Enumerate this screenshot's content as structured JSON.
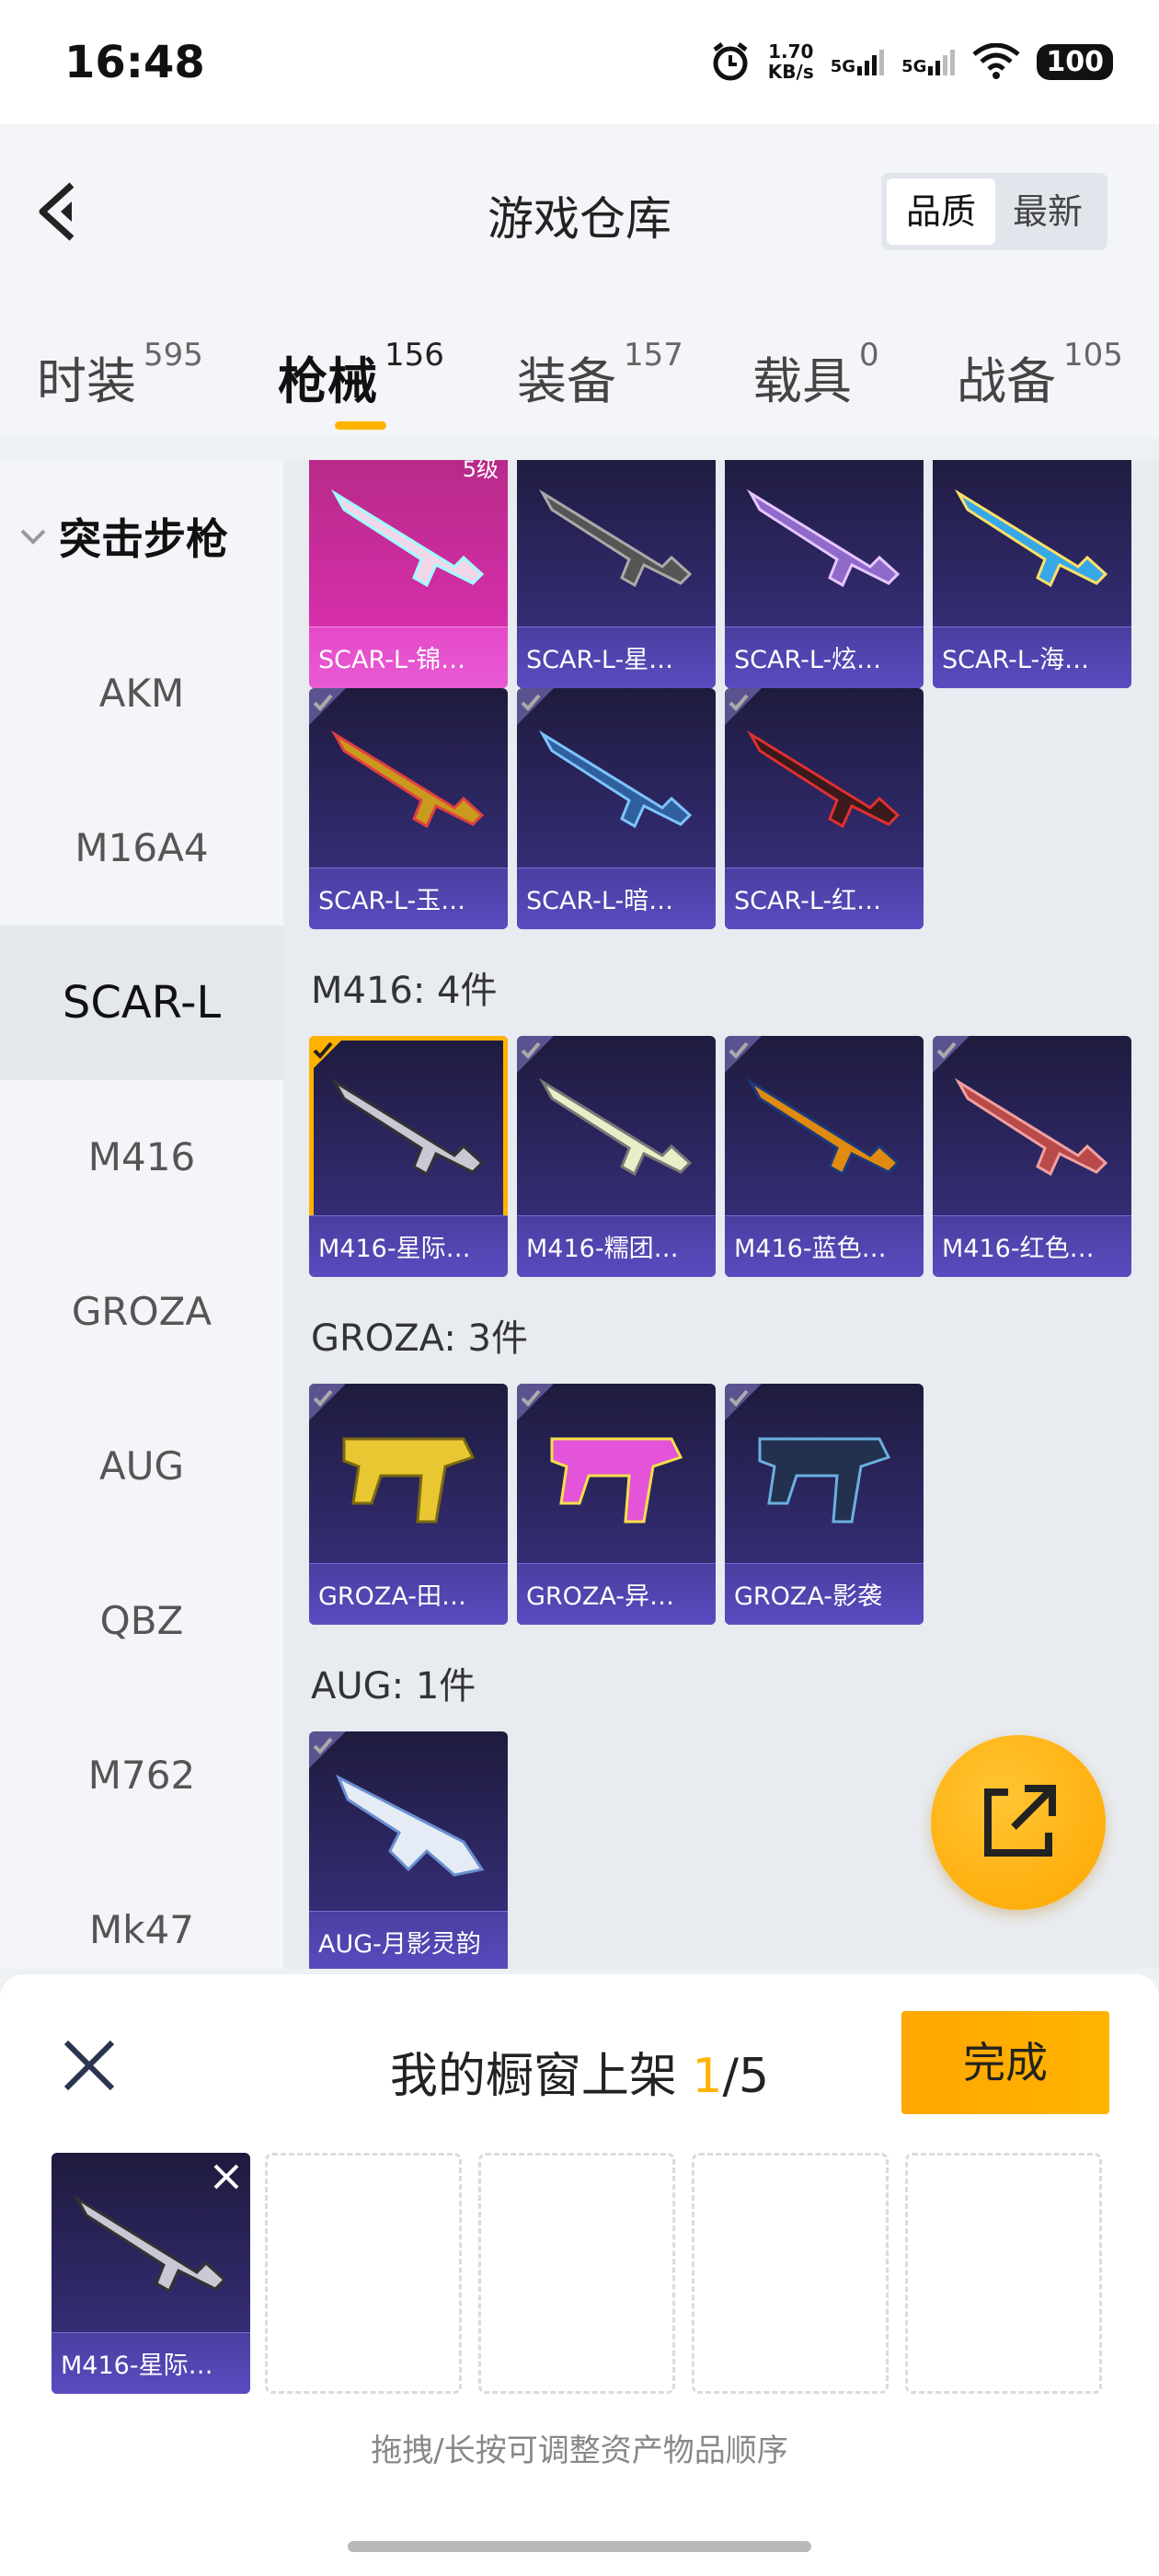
{
  "status_bar": {
    "time": "16:48",
    "net_speed_value": "1.70",
    "net_speed_unit": "KB/s",
    "sim1": "5G",
    "sim2": "5G",
    "battery": "100",
    "icons": [
      "alarm-icon",
      "signal-icon",
      "signal-icon",
      "wifi-icon",
      "battery-icon"
    ]
  },
  "header": {
    "title": "游戏仓库",
    "sort_options": [
      "品质",
      "最新"
    ],
    "selected_sort": "品质"
  },
  "tabs": [
    {
      "label": "时装",
      "count": "595"
    },
    {
      "label": "枪械",
      "count": "156",
      "active": true
    },
    {
      "label": "装备",
      "count": "157"
    },
    {
      "label": "载具",
      "count": "0"
    },
    {
      "label": "战备",
      "count": "105"
    }
  ],
  "sidebar": {
    "category": "突击步枪",
    "items": [
      "AKM",
      "M16A4",
      "SCAR-L",
      "M416",
      "GROZA",
      "AUG",
      "QBZ",
      "M762",
      "Mk47"
    ],
    "active": "SCAR-L"
  },
  "grid": {
    "scar_cards": [
      {
        "label": "SCAR-L-锦…",
        "badge": "5级"
      },
      {
        "label": "SCAR-L-星…"
      },
      {
        "label": "SCAR-L-炫…"
      },
      {
        "label": "SCAR-L-海…"
      },
      {
        "label": "SCAR-L-玉…"
      },
      {
        "label": "SCAR-L-暗…"
      },
      {
        "label": "SCAR-L-红…"
      }
    ],
    "m416_header": "M416: 4件",
    "m416_cards": [
      {
        "label": "M416-星际…",
        "selected": true
      },
      {
        "label": "M416-糯团…"
      },
      {
        "label": "M416-蓝色…"
      },
      {
        "label": "M416-红色…"
      }
    ],
    "groza_header": "GROZA: 3件",
    "groza_cards": [
      {
        "label": "GROZA-田…"
      },
      {
        "label": "GROZA-异…"
      },
      {
        "label": "GROZA-影袭"
      }
    ],
    "aug_header": "AUG: 1件",
    "aug_cards": [
      {
        "label": "AUG-月影灵韵"
      }
    ]
  },
  "fab": {
    "icon": "share-icon"
  },
  "panel": {
    "title_prefix": "我的橱窗上架",
    "count": "1",
    "total": "/5",
    "done_label": "完成",
    "filled_slot_label": "M416-星际…",
    "hint": "拖拽/长按可调整资产物品顺序"
  },
  "colors": {
    "accent": "#ffb300",
    "card_purple": "#3d3488",
    "card_legend": "#d42ea8"
  }
}
